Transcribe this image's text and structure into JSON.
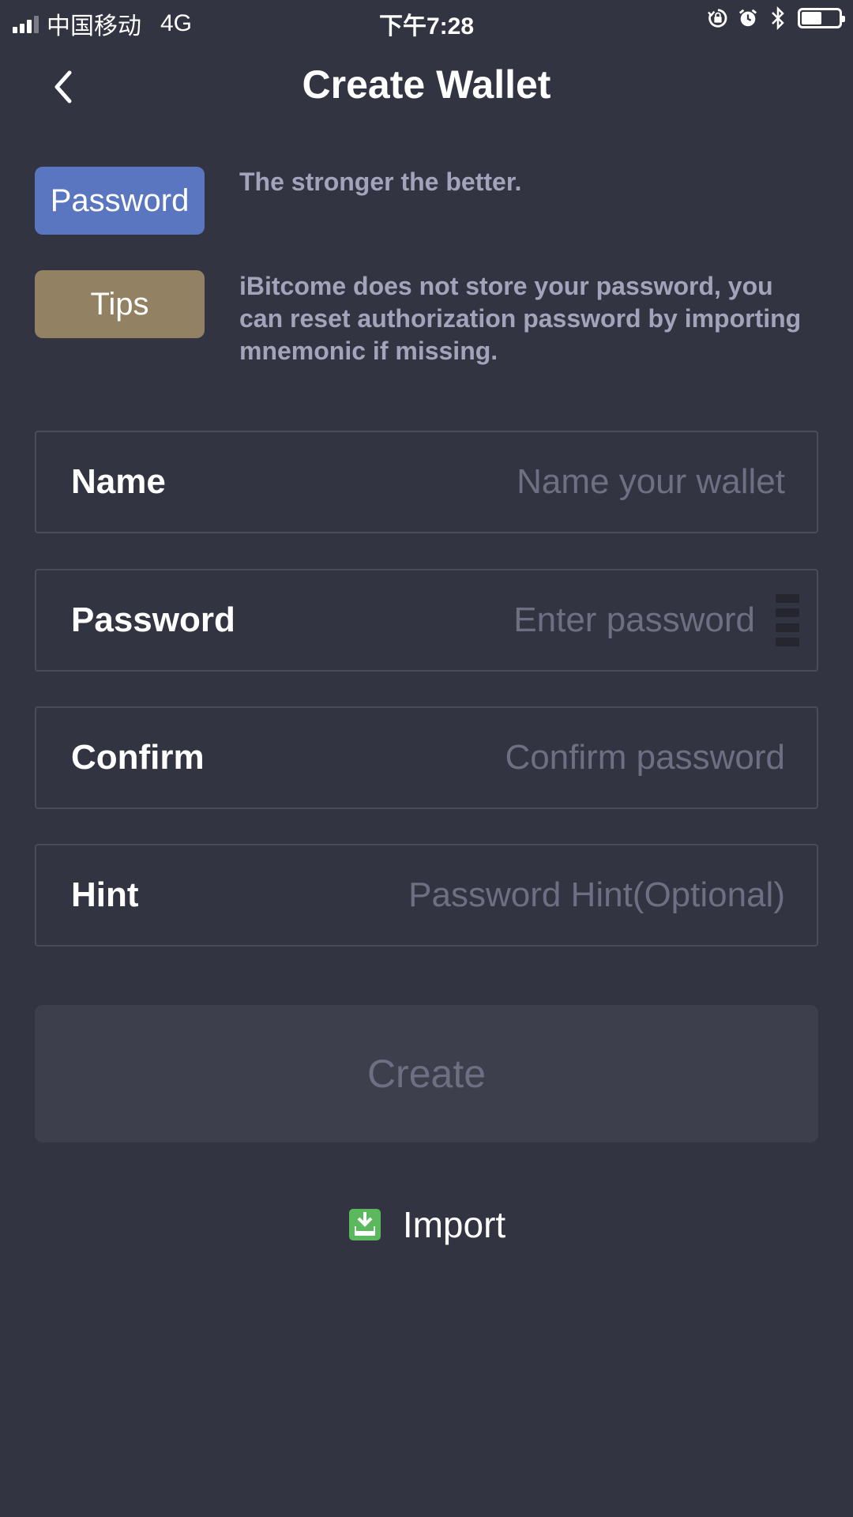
{
  "status_bar": {
    "carrier": "中国移动",
    "network": "4G",
    "time": "下午7:28",
    "battery_level": 0.55,
    "icons": [
      "signal-icon",
      "rotation-lock-icon",
      "alarm-icon",
      "bluetooth-icon",
      "battery-icon"
    ]
  },
  "header": {
    "title": "Create Wallet",
    "back_icon": "chevron-left-icon"
  },
  "info": {
    "password_tag": "Password",
    "password_text": "The stronger the better.",
    "tips_tag": "Tips",
    "tips_text": "iBitcome does not store your password, you can reset authorization password by importing mnemonic if missing."
  },
  "form": {
    "name_label": "Name",
    "name_placeholder": "Name your wallet",
    "password_label": "Password",
    "password_placeholder": "Enter password",
    "confirm_label": "Confirm",
    "confirm_placeholder": "Confirm password",
    "hint_label": "Hint",
    "hint_placeholder": "Password Hint(Optional)"
  },
  "actions": {
    "create_label": "Create",
    "import_label": "Import",
    "import_icon": "download-tray-icon"
  },
  "colors": {
    "background": "#333441",
    "password_tag": "#5b76c0",
    "tips_tag": "#928263",
    "info_text": "#a3a4bb",
    "placeholder": "#6e6f82",
    "create_button_bg": "#3e3f4d",
    "import_icon": "#5cb85c"
  }
}
